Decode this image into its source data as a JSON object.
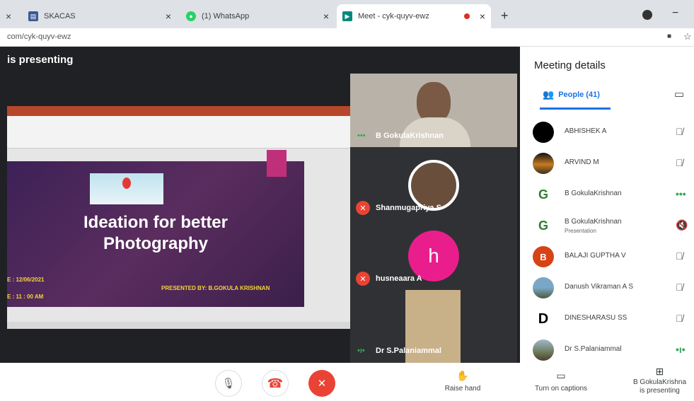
{
  "browser": {
    "tabs": [
      {
        "label": "SKACAS",
        "close": "×"
      },
      {
        "label": "(1) WhatsApp",
        "close": "×"
      },
      {
        "label": "Meet - cyk-quyv-ewz",
        "close": "×"
      }
    ],
    "first_tab_close": "×",
    "new_tab": "+",
    "minimize": "−",
    "url": "com/cyk-quyv-ewz"
  },
  "stage": {
    "presenting_text": "is presenting",
    "slide": {
      "title_line1": "Ideation for better",
      "title_line2": "Photography",
      "date": "E : 12/06/2021",
      "time": "E : 11 : 00 AM",
      "presented_by": "PRESENTED BY: B.GOKULA KRISHNAN"
    }
  },
  "tiles": [
    {
      "name": "B GokulaKrishnan",
      "indicator": "•••"
    },
    {
      "name": "Shanmugapriya S"
    },
    {
      "name": "husneaara A",
      "avatar_letter": "h"
    },
    {
      "name": "Dr S.Palaniammal",
      "indicator": "•ı•"
    }
  ],
  "panel": {
    "title": "Meeting details",
    "people_tab": "People (41)",
    "people": [
      {
        "name": "ABHISHEK A"
      },
      {
        "name": "ARVIND M"
      },
      {
        "name": "B GokulaKrishnan",
        "status": "•••"
      },
      {
        "name": "B GokulaKrishnan",
        "sub": "Presentation"
      },
      {
        "name": "BALAJI GUPTHA V",
        "avatar_letter": "B"
      },
      {
        "name": "Danush Vikraman A S"
      },
      {
        "name": "DINESHARASU SS",
        "avatar_letter": "D"
      },
      {
        "name": "Dr S.Palaniammal",
        "status": "•ı•"
      }
    ]
  },
  "bottom": {
    "raise_hand": "Raise hand",
    "captions": "Turn on captions",
    "presenting_line1": "B GokulaKrishna",
    "presenting_line2": "is presenting"
  },
  "colors": {
    "accent": "#1a73e8",
    "hangup": "#ea4335",
    "speaking": "#34a853"
  }
}
